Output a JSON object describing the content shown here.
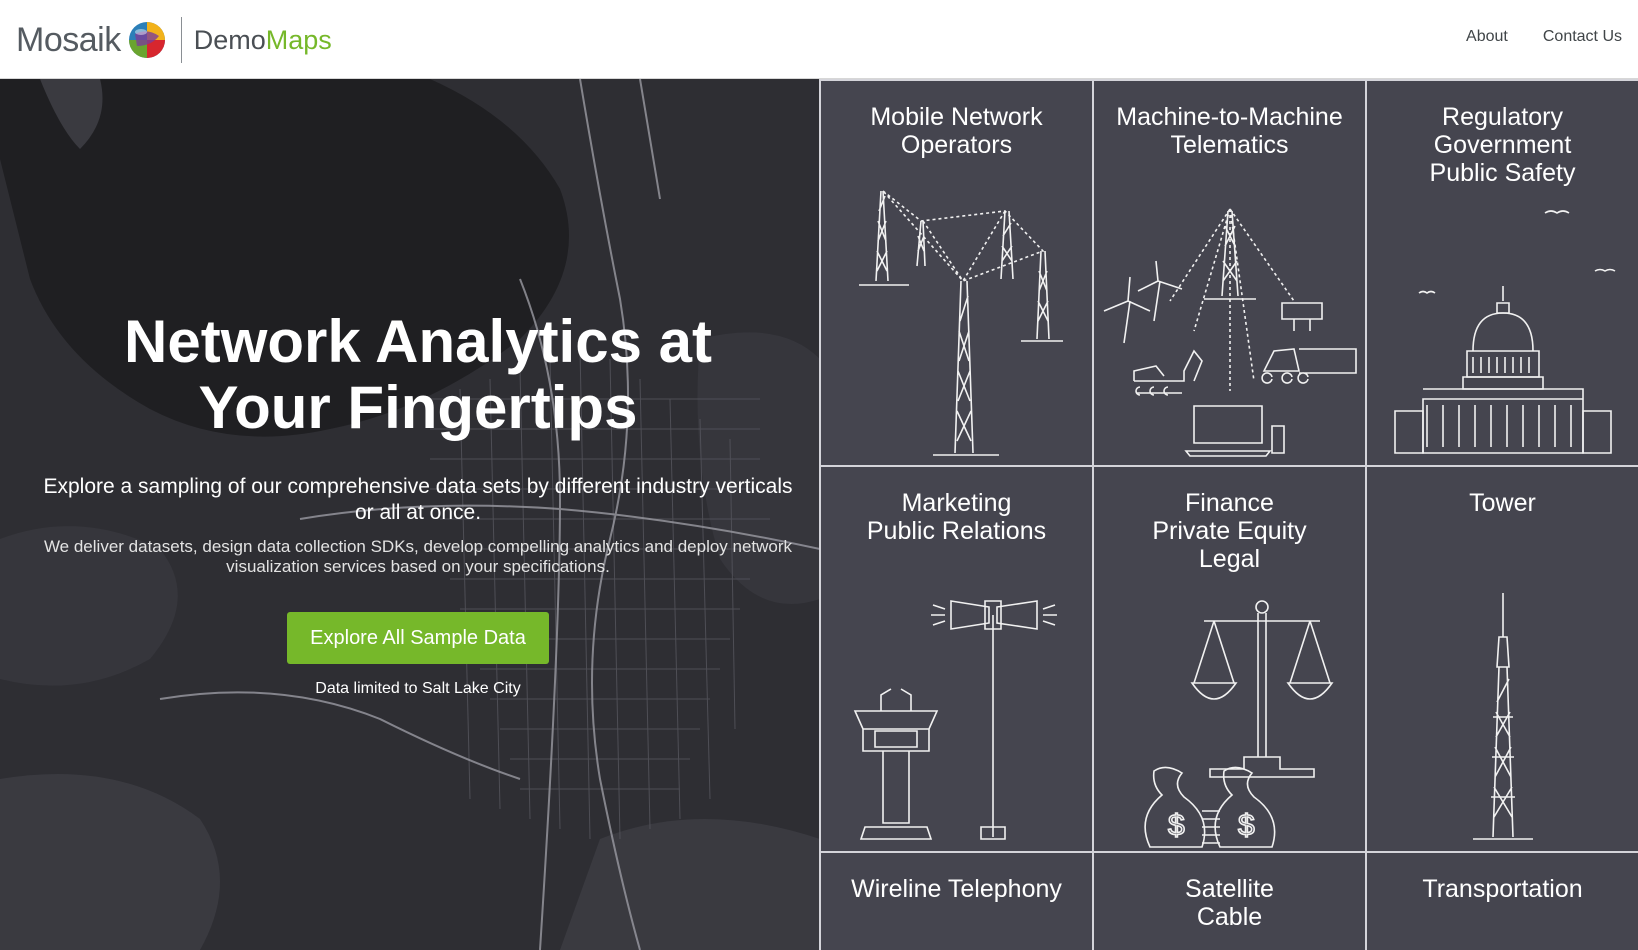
{
  "header": {
    "brand": "Mosaik",
    "product_prefix": "Demo",
    "product_suffix": "Maps",
    "nav": [
      {
        "label": "About"
      },
      {
        "label": "Contact Us"
      }
    ]
  },
  "hero": {
    "title_line1": "Network Analytics at",
    "title_line2": "Your Fingertips",
    "subtitle": "Explore a sampling of our comprehensive data sets by different industry verticals or all at once.",
    "description": "We deliver datasets, design data collection SDKs, develop compelling analytics and deploy network visualization services based on your specifications.",
    "cta_label": "Explore All Sample Data",
    "note": "Data limited to Salt Lake City"
  },
  "tiles": [
    {
      "label": "Mobile Network\nOperators",
      "icon": "cell-towers-icon"
    },
    {
      "label": "Machine-to-Machine\nTelematics",
      "icon": "telematics-icon"
    },
    {
      "label": "Regulatory\nGovernment\nPublic Safety",
      "icon": "capitol-icon"
    },
    {
      "label": "Marketing\nPublic Relations",
      "icon": "podium-megaphone-icon"
    },
    {
      "label": "Finance\nPrivate Equity\nLegal",
      "icon": "scales-money-icon"
    },
    {
      "label": "Tower",
      "icon": "tower-icon"
    },
    {
      "label": "Wireline Telephony",
      "icon": ""
    },
    {
      "label": "Satellite\nCable",
      "icon": ""
    },
    {
      "label": "Transportation",
      "icon": ""
    }
  ],
  "colors": {
    "accent": "#76b82a",
    "tile_bg": "#45454f",
    "hero_bg": "#2b2b2f"
  }
}
